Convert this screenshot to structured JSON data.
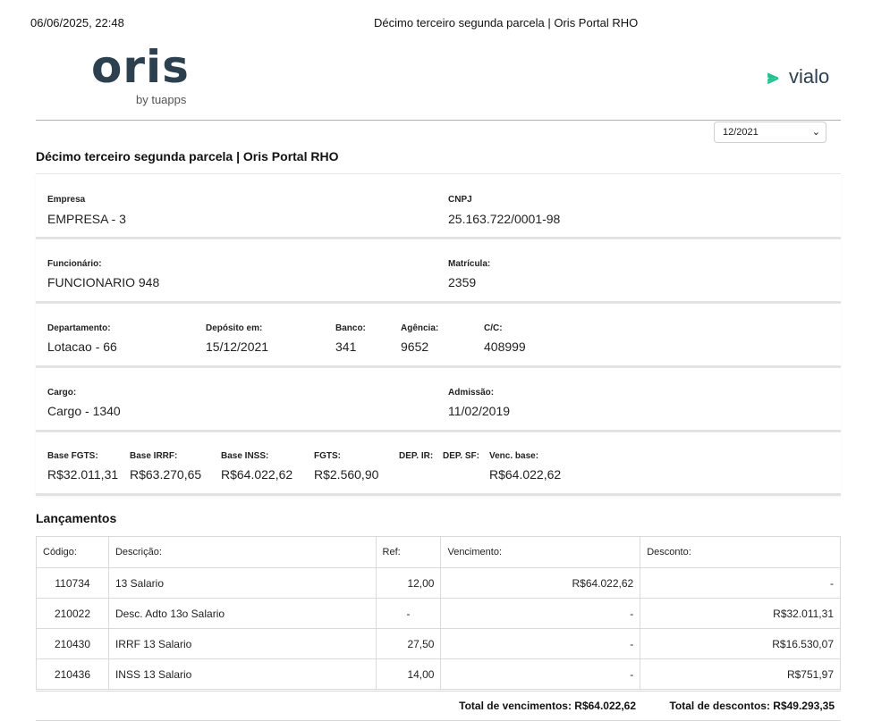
{
  "print_header": {
    "datetime": "06/06/2025, 22:48",
    "title": "Décimo terceiro segunda parcela | Oris Portal RHO"
  },
  "logos": {
    "oris": "oris",
    "oris_sub": "by tuapps",
    "vialo": "vialo"
  },
  "period_select": {
    "value": "12/2021"
  },
  "page_title": "Décimo terceiro segunda parcela | Oris Portal RHO",
  "empresa": {
    "label": "Empresa",
    "value": "EMPRESA - 3"
  },
  "cnpj": {
    "label": "CNPJ",
    "value": "25.163.722/0001-98"
  },
  "funcionario": {
    "label": "Funcionário:",
    "value": "FUNCIONARIO 948"
  },
  "matricula": {
    "label": "Matrícula:",
    "value": "2359"
  },
  "departamento": {
    "label": "Departamento:",
    "value": "Lotacao - 66"
  },
  "deposito": {
    "label": "Depósito em:",
    "value": "15/12/2021"
  },
  "banco": {
    "label": "Banco:",
    "value": "341"
  },
  "agencia": {
    "label": "Agência:",
    "value": "9652"
  },
  "cc": {
    "label": "C/C:",
    "value": "408999"
  },
  "cargo": {
    "label": "Cargo:",
    "value": "Cargo - 1340"
  },
  "admissao": {
    "label": "Admissão:",
    "value": "11/02/2019"
  },
  "bases": {
    "fgts_base": {
      "label": "Base FGTS:",
      "value": "R$32.011,31"
    },
    "irrf_base": {
      "label": "Base IRRF:",
      "value": "R$63.270,65"
    },
    "inss_base": {
      "label": "Base INSS:",
      "value": "R$64.022,62"
    },
    "fgts": {
      "label": "FGTS:",
      "value": "R$2.560,90"
    },
    "dep_ir": {
      "label": "DEP. IR:",
      "value": ""
    },
    "dep_sf": {
      "label": "DEP. SF:",
      "value": ""
    },
    "venc_base": {
      "label": "Venc. base:",
      "value": "R$64.022,62"
    }
  },
  "lancamentos": {
    "title": "Lançamentos",
    "headers": {
      "codigo": "Código:",
      "descricao": "Descrição:",
      "ref": "Ref:",
      "vencimento": "Vencimento:",
      "desconto": "Desconto:"
    },
    "rows": [
      {
        "codigo": "110734",
        "descricao": "13 Salario",
        "ref": "12,00",
        "vencimento": "R$64.022,62",
        "desconto": "-"
      },
      {
        "codigo": "210022",
        "descricao": "Desc. Adto 13o Salario",
        "ref": "-",
        "vencimento": "-",
        "desconto": "R$32.011,31"
      },
      {
        "codigo": "210430",
        "descricao": "IRRF 13 Salario",
        "ref": "27,50",
        "vencimento": "-",
        "desconto": "R$16.530,07"
      },
      {
        "codigo": "210436",
        "descricao": "INSS 13 Salario",
        "ref": "14,00",
        "vencimento": "-",
        "desconto": "R$751,97"
      }
    ],
    "total_vencimentos": "Total de vencimentos: R$64.022,62",
    "total_descontos": "Total de descontos: R$49.293,35"
  }
}
